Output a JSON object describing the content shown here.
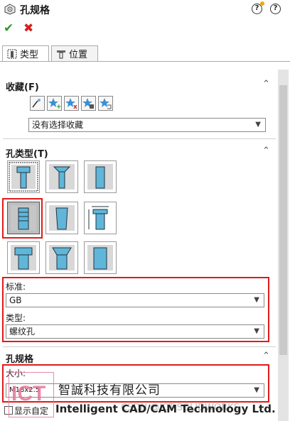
{
  "header": {
    "title": "孔规格",
    "help1": "?",
    "help2": "?"
  },
  "tabs": [
    {
      "label": "类型"
    },
    {
      "label": "位置"
    }
  ],
  "favorites": {
    "title": "收藏(F)",
    "select_value": "没有选择收藏"
  },
  "hole_type": {
    "title": "孔类型(T)"
  },
  "standard": {
    "label": "标准:",
    "value": "GB"
  },
  "type": {
    "label": "类型:",
    "value": "螺纹孔"
  },
  "spec": {
    "title": "孔规格",
    "size_label": "大小:",
    "size_value": "M18x2.5"
  },
  "footer": {
    "checkbox_label": "显示自定",
    "logo_text": "ICT",
    "company_cn": "智誠科技有限公司",
    "company_en": "Intelligent CAD/CAM Technology Ltd.",
    "watermark": "CSDN @ICT-SOLIDWORKS"
  },
  "colors": {
    "accent_red": "#e21a1a",
    "ok_green": "#2e9a2e",
    "hole_blue": "#5fb6d9"
  }
}
